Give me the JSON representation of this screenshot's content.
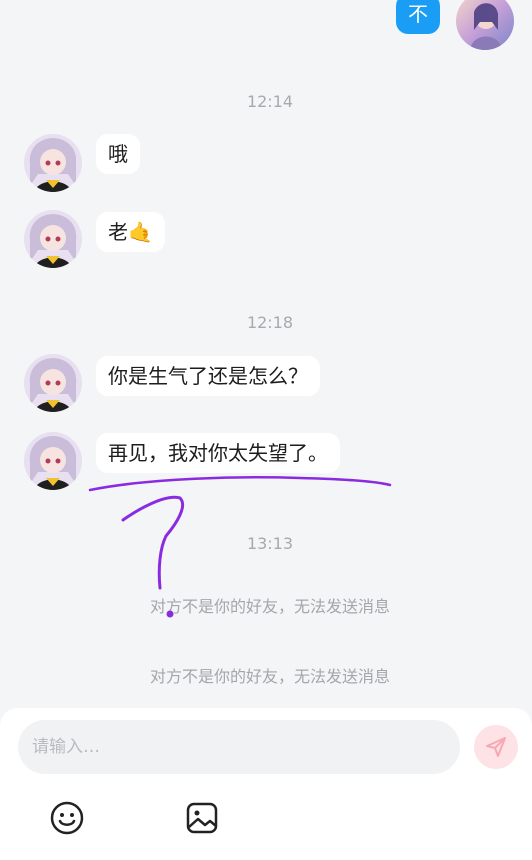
{
  "chat": {
    "messages": [
      {
        "side": "me",
        "text": "不"
      },
      {
        "side": "other",
        "text": "哦"
      },
      {
        "side": "other",
        "text": "老",
        "emoji": "🤙"
      },
      {
        "side": "other",
        "text": "你是生气了还是怎么？"
      },
      {
        "side": "other",
        "text": "再见，我对你太失望了。"
      }
    ],
    "timestamps": [
      "12:14",
      "12:18",
      "13:13"
    ],
    "system_notices": [
      "对方不是你的好友，无法发送消息",
      "对方不是你的好友，无法发送消息"
    ]
  },
  "composer": {
    "placeholder": "请输入…",
    "send_icon": "send-icon",
    "tools": [
      "smiley-icon",
      "image-icon"
    ]
  },
  "colors": {
    "background": "#f4f5f7",
    "my_bubble": "#1a9ef5",
    "other_bubble": "#ffffff",
    "annotation": "#8a2be2",
    "send_button": "#fde3e6"
  }
}
